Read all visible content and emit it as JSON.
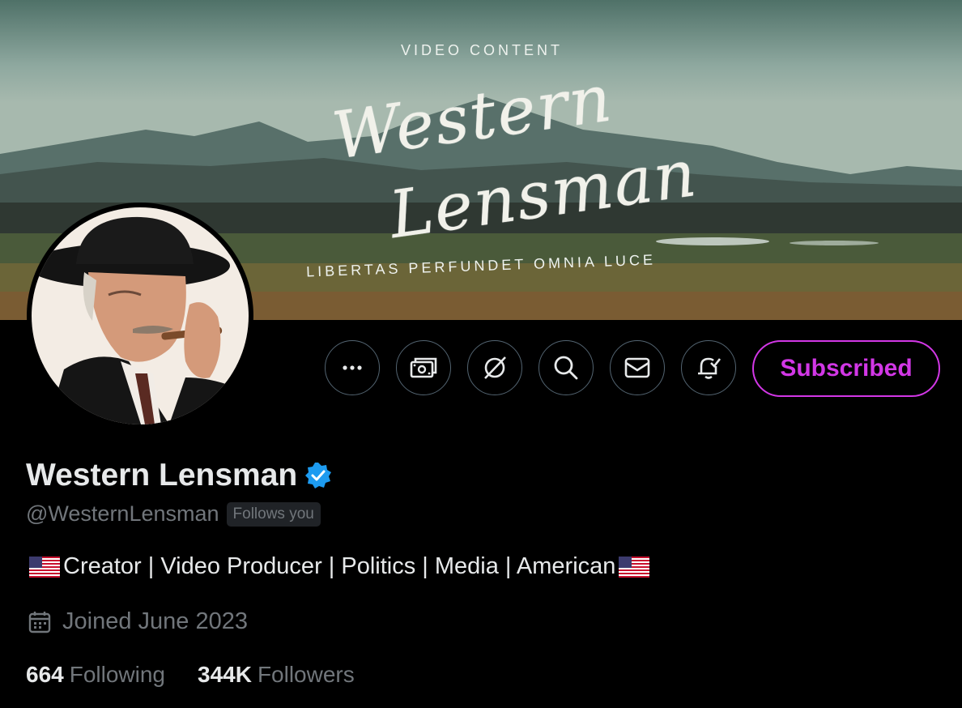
{
  "banner": {
    "subtitle": "VIDEO CONTENT",
    "title_line1": "Western",
    "title_line2": "Lensman",
    "motto": "LIBERTAS PERFUNDET OMNIA LUCE"
  },
  "actions": {
    "more_icon": "more-horizontal-icon",
    "tip_icon": "money-icon",
    "grok_icon": "grok-icon",
    "search_icon": "search-icon",
    "message_icon": "envelope-icon",
    "notify_icon": "bell-check-icon",
    "subscribe_label": "Subscribed",
    "accent_color": "#d237e6"
  },
  "profile": {
    "display_name": "Western Lensman",
    "verified_icon": "verified-badge-icon",
    "handle": "@WesternLensman",
    "follows_you": "Follows you",
    "bio": "Creator | Video Producer | Politics | Media | American",
    "bio_flag": "us-flag-emoji",
    "joined_icon": "calendar-icon",
    "joined": "Joined June 2023"
  },
  "stats": {
    "following_count": "664",
    "following_label": "Following",
    "followers_count": "344K",
    "followers_label": "Followers"
  }
}
